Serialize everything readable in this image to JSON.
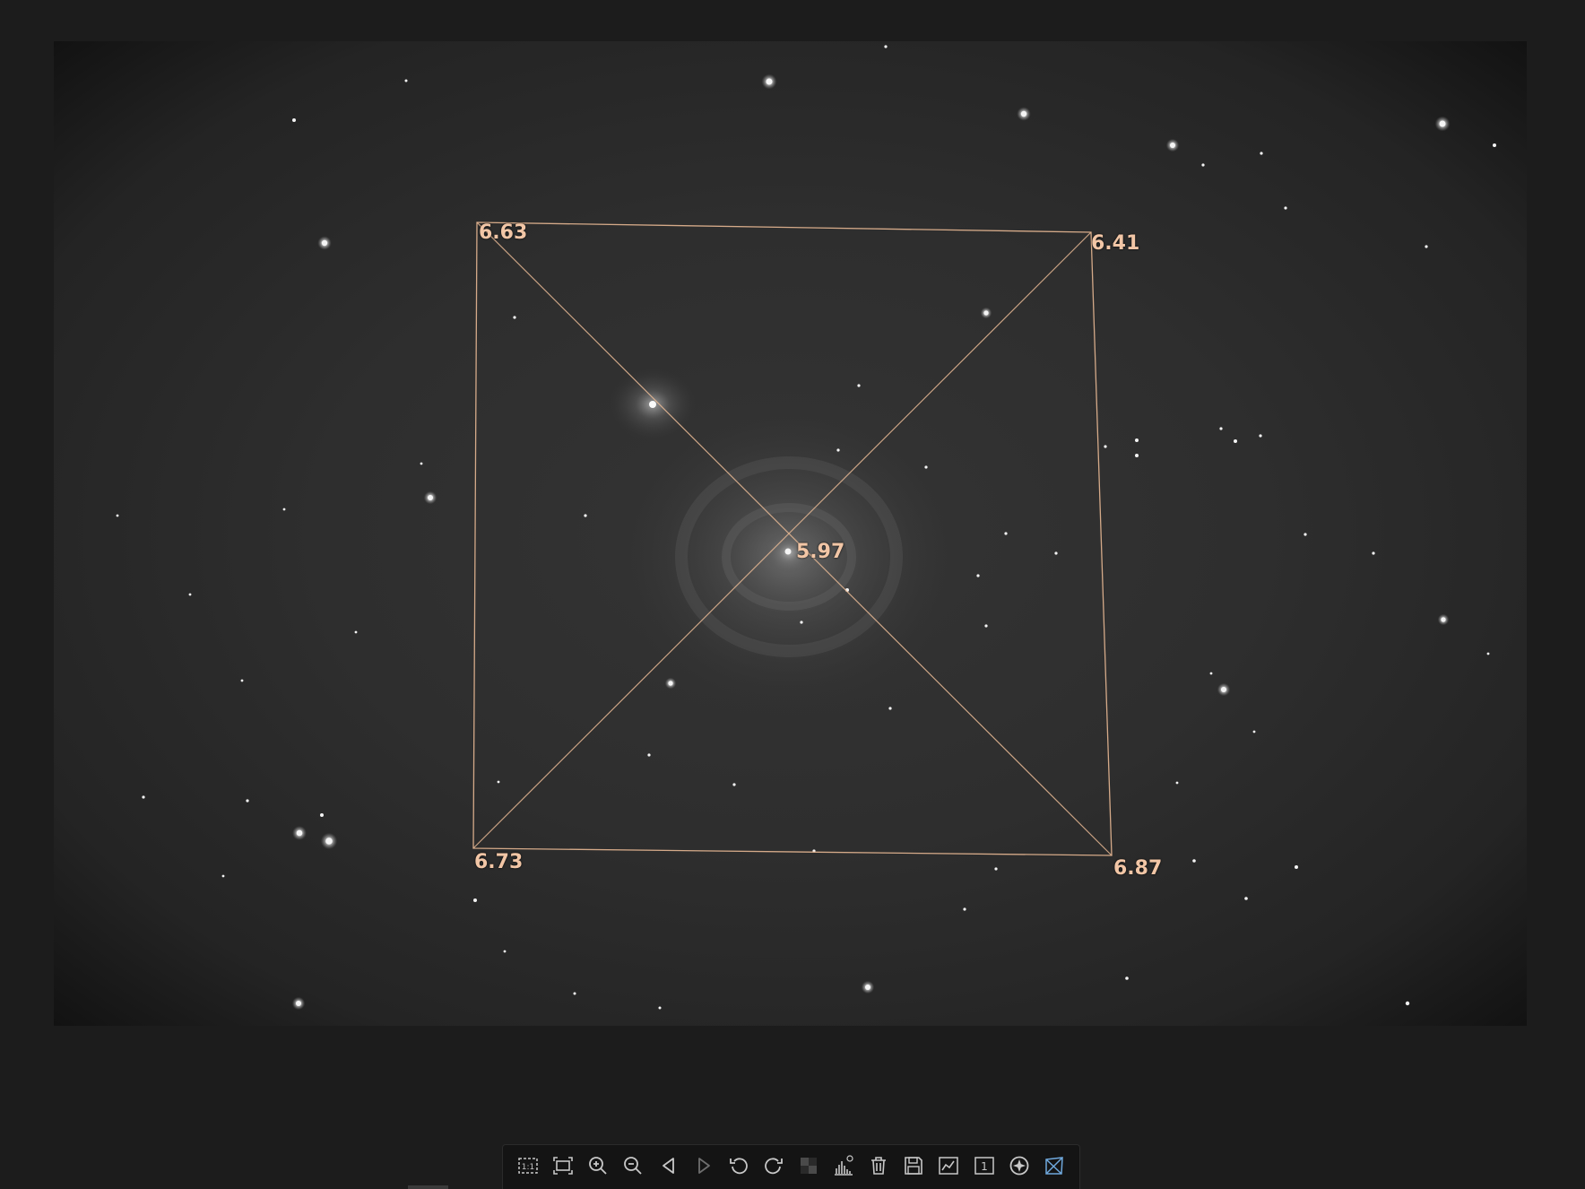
{
  "viewer": {
    "tilt_overlay": {
      "top_left": "6.63",
      "top_right": "6.41",
      "center": "5.97",
      "bottom_left": "6.73",
      "bottom_right": "6.87"
    },
    "overlay_color": "#e8b894",
    "label_color": "#f2c6a6"
  },
  "toolbar": {
    "buttons": [
      {
        "name": "actual-size-button",
        "icon": "one-to-one-icon"
      },
      {
        "name": "fit-to-window-button",
        "icon": "fit-window-icon"
      },
      {
        "name": "zoom-in-button",
        "icon": "zoom-in-icon"
      },
      {
        "name": "zoom-out-button",
        "icon": "zoom-out-icon"
      },
      {
        "name": "previous-image-button",
        "icon": "triangle-left-icon"
      },
      {
        "name": "next-image-button",
        "icon": "triangle-right-icon"
      },
      {
        "name": "rotate-left-button",
        "icon": "rotate-left-icon"
      },
      {
        "name": "rotate-right-button",
        "icon": "rotate-right-icon"
      },
      {
        "name": "debayer-button",
        "icon": "checker-icon"
      },
      {
        "name": "histogram-button",
        "icon": "histogram-icon"
      },
      {
        "name": "delete-button",
        "icon": "trash-icon"
      },
      {
        "name": "save-button",
        "icon": "floppy-icon"
      },
      {
        "name": "star-detect-button",
        "icon": "graph-icon"
      },
      {
        "name": "single-frame-button",
        "icon": "one-box-icon"
      },
      {
        "name": "crosshair-button",
        "icon": "crosshair-icon"
      },
      {
        "name": "tilt-analysis-button",
        "icon": "tilt-icon",
        "active": true
      }
    ],
    "icon_color": "#c8c8c8",
    "active_color": "#6fa8dc"
  }
}
